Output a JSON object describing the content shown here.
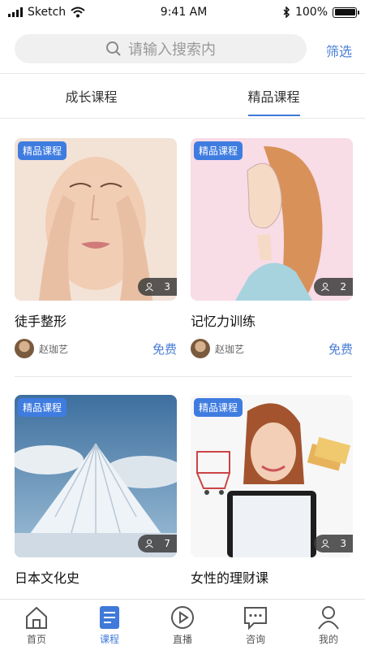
{
  "status_bar": {
    "carrier": "Sketch",
    "time": "9:41 AM",
    "battery": "100%"
  },
  "search": {
    "placeholder": "请输入搜索内",
    "filter": "筛选"
  },
  "tabs": [
    {
      "label": "成长课程",
      "active": false
    },
    {
      "label": "精品课程",
      "active": true
    }
  ],
  "courses": [
    {
      "badge": "精品课程",
      "count": "3",
      "title": "徒手整形",
      "author": "赵珈艺",
      "price": "免费"
    },
    {
      "badge": "精品课程",
      "count": "2",
      "title": "记忆力训练",
      "author": "赵珈艺",
      "price": "免费"
    },
    {
      "badge": "精品课程",
      "count": "7",
      "title": "日本文化史",
      "author": "",
      "price": ""
    },
    {
      "badge": "精品课程",
      "count": "3",
      "title": "女性的理财课",
      "author": "",
      "price": ""
    }
  ],
  "bottom_nav": [
    {
      "label": "首页",
      "icon": "home-icon",
      "active": false
    },
    {
      "label": "课程",
      "icon": "course-icon",
      "active": true
    },
    {
      "label": "直播",
      "icon": "play-icon",
      "active": false
    },
    {
      "label": "咨询",
      "icon": "chat-icon",
      "active": false
    },
    {
      "label": "我的",
      "icon": "user-icon",
      "active": false
    }
  ],
  "colors": {
    "accent": "#3f79d9",
    "badge": "#3f7ce0",
    "price": "#4a7fd6"
  }
}
